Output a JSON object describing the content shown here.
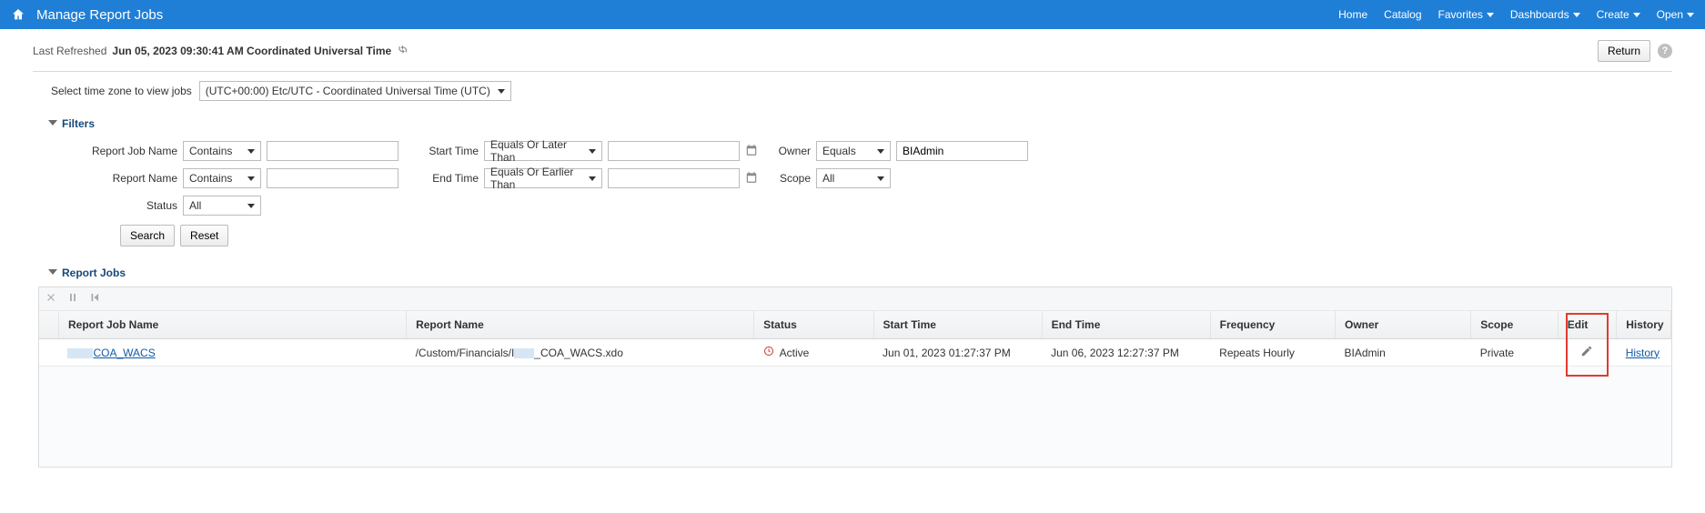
{
  "topbar": {
    "title": "Manage Report Jobs",
    "nav": {
      "home": "Home",
      "catalog": "Catalog",
      "favorites": "Favorites",
      "dashboards": "Dashboards",
      "create": "Create",
      "open": "Open"
    }
  },
  "refresh": {
    "prefix": "Last Refreshed",
    "timestamp": "Jun 05, 2023 09:30:41 AM Coordinated Universal Time"
  },
  "actions": {
    "return": "Return"
  },
  "timezone": {
    "label": "Select time zone to view jobs",
    "value": "(UTC+00:00) Etc/UTC - Coordinated Universal Time (UTC)"
  },
  "sections": {
    "filters": "Filters",
    "report_jobs": "Report Jobs"
  },
  "filters": {
    "reportJobName": {
      "label": "Report Job Name",
      "op": "Contains",
      "value": ""
    },
    "reportName": {
      "label": "Report Name",
      "op": "Contains",
      "value": ""
    },
    "status": {
      "label": "Status",
      "value": "All"
    },
    "startTime": {
      "label": "Start Time",
      "op": "Equals Or Later Than",
      "value": ""
    },
    "endTime": {
      "label": "End Time",
      "op": "Equals Or Earlier Than",
      "value": ""
    },
    "owner": {
      "label": "Owner",
      "op": "Equals",
      "value": "BIAdmin"
    },
    "scope": {
      "label": "Scope",
      "value": "All"
    },
    "buttons": {
      "search": "Search",
      "reset": "Reset"
    }
  },
  "table": {
    "headers": {
      "jobName": "Report Job Name",
      "reportName": "Report Name",
      "status": "Status",
      "startTime": "Start Time",
      "endTime": "End Time",
      "frequency": "Frequency",
      "owner": "Owner",
      "scope": "Scope",
      "edit": "Edit",
      "history": "History"
    },
    "rows": [
      {
        "jobName": "COA_WACS",
        "reportName_prefix": "/Custom/Financials/I",
        "reportName_suffix": "_COA_WACS.xdo",
        "status": "Active",
        "startTime": "Jun 01, 2023 01:27:37 PM",
        "endTime": "Jun 06, 2023 12:27:37 PM",
        "frequency": "Repeats Hourly",
        "owner": "BIAdmin",
        "scope": "Private",
        "historyLink": "History"
      }
    ]
  }
}
